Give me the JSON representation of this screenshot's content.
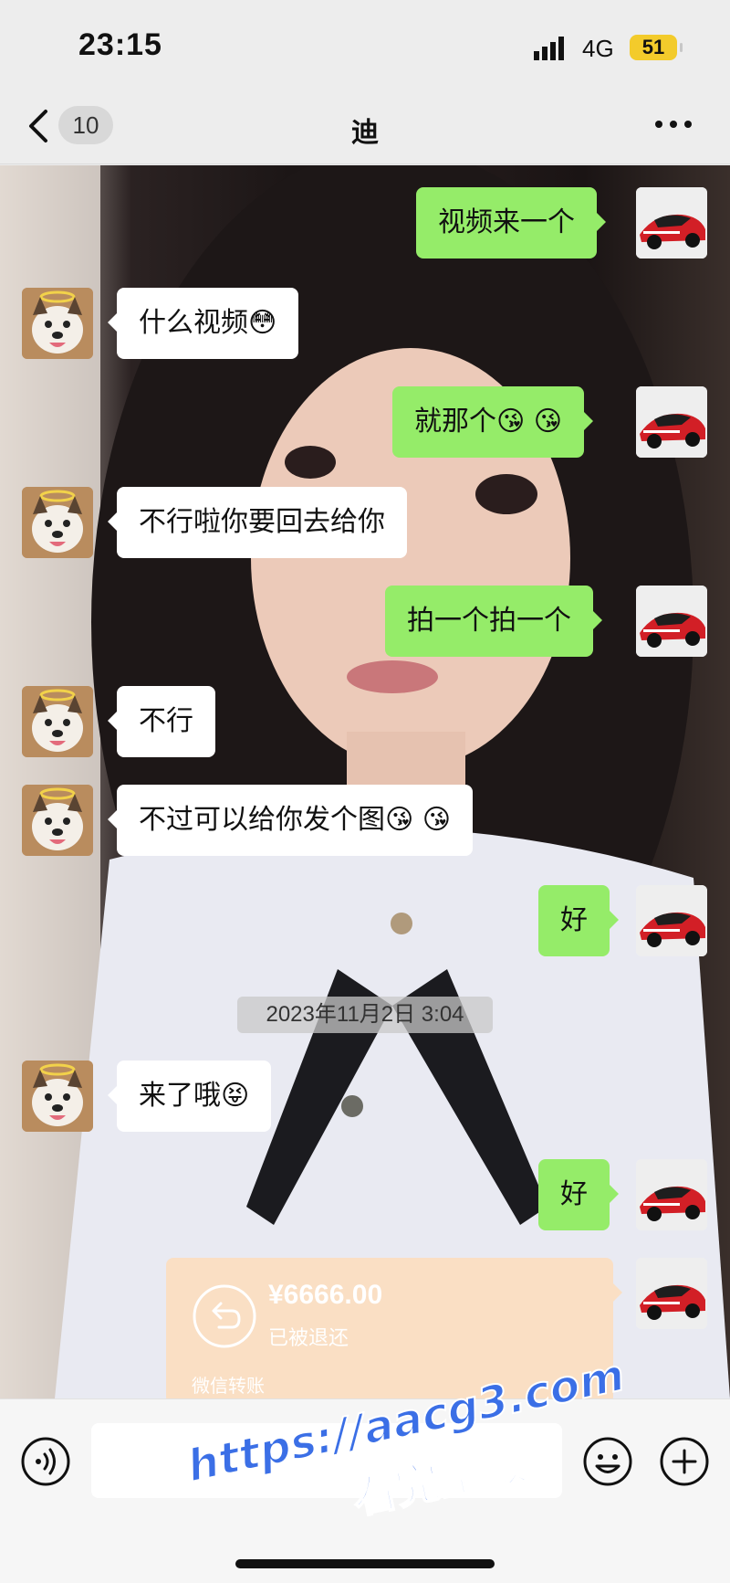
{
  "status_bar": {
    "time": "23:15",
    "network": "4G",
    "battery": "51"
  },
  "nav": {
    "unread_count": "10",
    "title": "迪"
  },
  "messages": [
    {
      "side": "right",
      "text": "视频来一个"
    },
    {
      "side": "left",
      "text": "什么视频",
      "emoji": "😳"
    },
    {
      "side": "right",
      "text": "就那个",
      "emoji": "😘 😘"
    },
    {
      "side": "left",
      "text": "不行啦你要回去给你"
    },
    {
      "side": "right",
      "text": "拍一个拍一个"
    },
    {
      "side": "left",
      "text": "不行"
    },
    {
      "side": "left",
      "text": "不过可以给你发个图",
      "emoji": "😘 😘"
    },
    {
      "side": "right",
      "text": "好"
    },
    {
      "side": "left",
      "text": "来了哦",
      "emoji": "😝"
    },
    {
      "side": "right",
      "text": "好"
    }
  ],
  "timestamp": "2023年11月2日 3:04",
  "transfer": {
    "amount": "¥6666.00",
    "status": "已被退还",
    "source": "微信转账"
  },
  "watermark": {
    "url": "https://aacg3.com",
    "note": "看完整版"
  },
  "colors": {
    "sent_bubble": "#95ec69",
    "received_bubble": "#ffffff",
    "transfer_card": "#fadfc4"
  }
}
